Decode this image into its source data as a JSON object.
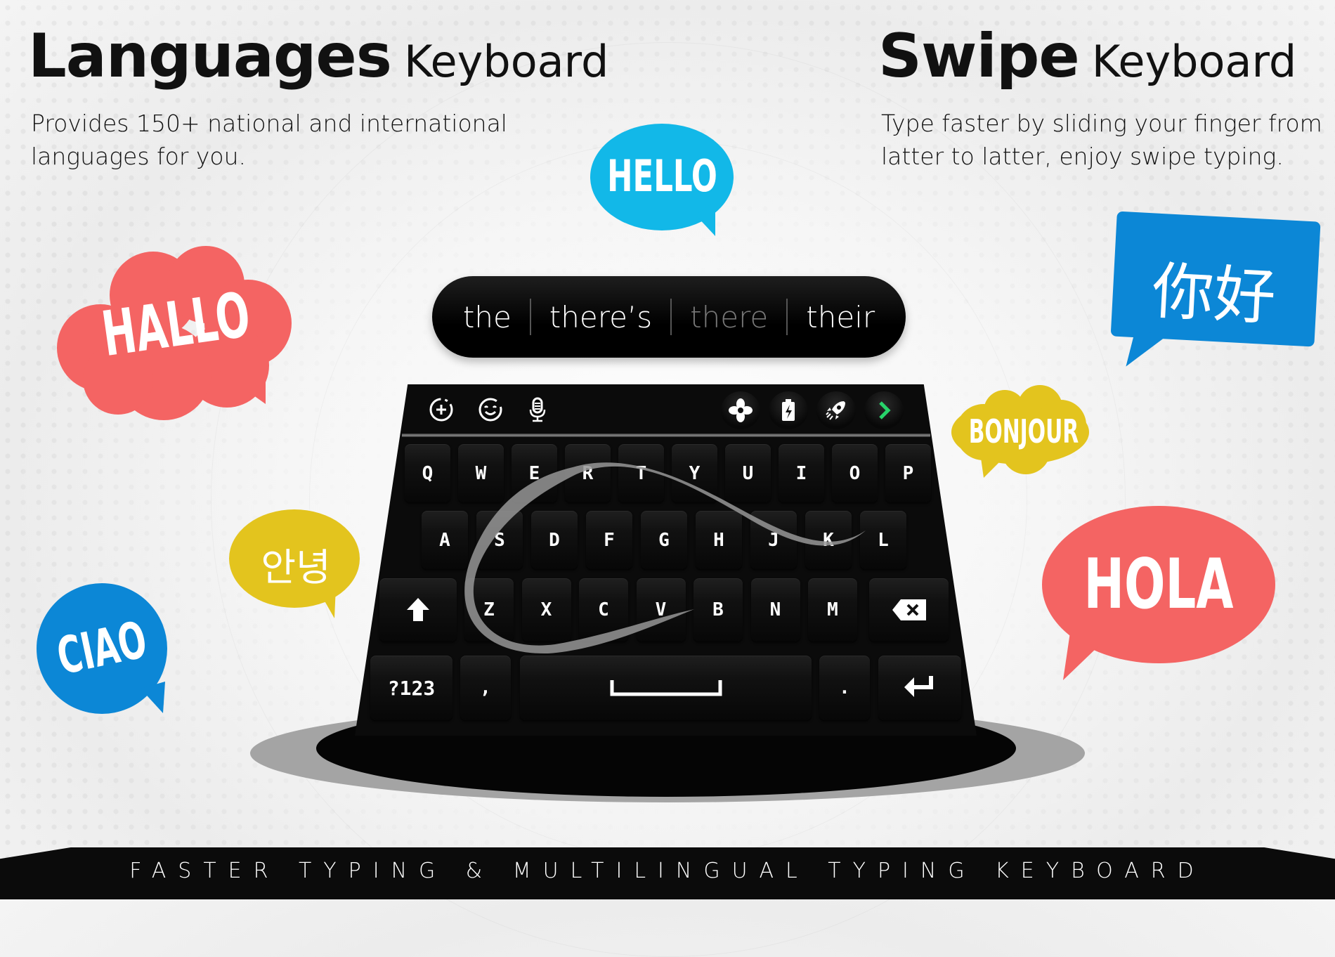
{
  "left_feature": {
    "title_bold": "Languages",
    "title_light": "Keyboard",
    "description_lines": [
      "Provides 150+ national and international",
      "languages for you."
    ]
  },
  "right_feature": {
    "title_bold": "Swipe",
    "title_light": "Keyboard",
    "description_lines": [
      "Type faster by sliding your finger from",
      "latter to latter, enjoy swipe typing."
    ]
  },
  "bubbles": {
    "hello": {
      "text": "HELLO",
      "color": "#12b8e8"
    },
    "hallo": {
      "text": "HALLO",
      "color": "#f46463"
    },
    "nihao": {
      "text": "你好",
      "color": "#0c87d6"
    },
    "bonjour": {
      "text": "BONJOUR",
      "color": "#e3c41e"
    },
    "annyeong": {
      "text": "안녕",
      "color": "#e3c41e"
    },
    "ciao": {
      "text": "CIAO",
      "color": "#0c87d6"
    },
    "hola": {
      "text": "HOLA",
      "color": "#f46463"
    }
  },
  "suggestions": [
    {
      "word": "the",
      "dimmed": false
    },
    {
      "word": "there’s",
      "dimmed": false
    },
    {
      "word": "there",
      "dimmed": true
    },
    {
      "word": "their",
      "dimmed": false
    }
  ],
  "toolbar": {
    "left_icons": [
      "add-circle-icon",
      "emoji-icon",
      "microphone-icon"
    ],
    "right_icons": [
      "fan-cleaner-icon",
      "battery-icon",
      "rocket-boost-icon",
      "chevron-right-icon"
    ],
    "accent": "#27d36a"
  },
  "keyboard": {
    "row1": [
      "Q",
      "W",
      "E",
      "R",
      "T",
      "Y",
      "U",
      "I",
      "O",
      "P"
    ],
    "row2": [
      "A",
      "S",
      "D",
      "F",
      "G",
      "H",
      "J",
      "K",
      "L"
    ],
    "row3": [
      "Z",
      "X",
      "C",
      "V",
      "B",
      "N",
      "M"
    ],
    "numbers_label": "?123",
    "comma_label": ",",
    "period_label": "."
  },
  "footer": {
    "tagline": "FASTER TYPING & MULTILINGUAL TYPING KEYBOARD"
  }
}
